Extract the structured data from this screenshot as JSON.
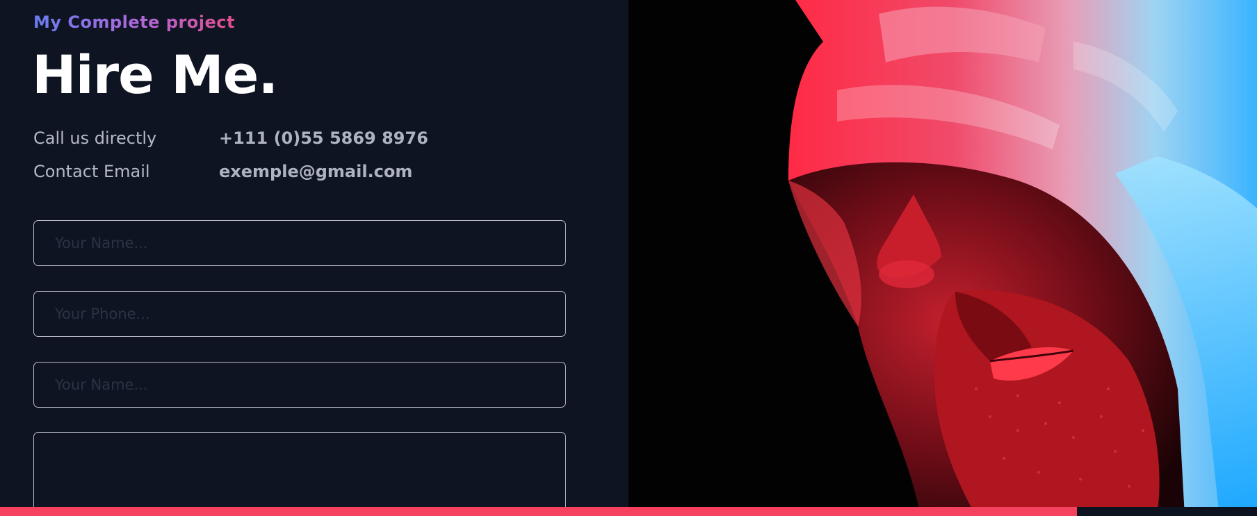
{
  "hero": {
    "eyebrow": "My Complete project",
    "title": "Hire Me."
  },
  "contact": [
    {
      "label": "Call us directly",
      "value": "+111 (0)55 5869 8976"
    },
    {
      "label": "Contact Email",
      "value": "exemple@gmail.com"
    }
  ],
  "form": {
    "name_placeholder": "Your Name...",
    "phone_placeholder": "Your Phone...",
    "second_name_placeholder": "Your Name...",
    "message_value": ""
  },
  "colors": {
    "background": "#0f1423",
    "accent": "#f5405e",
    "eyebrow_gradient": [
      "#6a7df0",
      "#e24e8a"
    ]
  },
  "scroll_progress": 0.857
}
